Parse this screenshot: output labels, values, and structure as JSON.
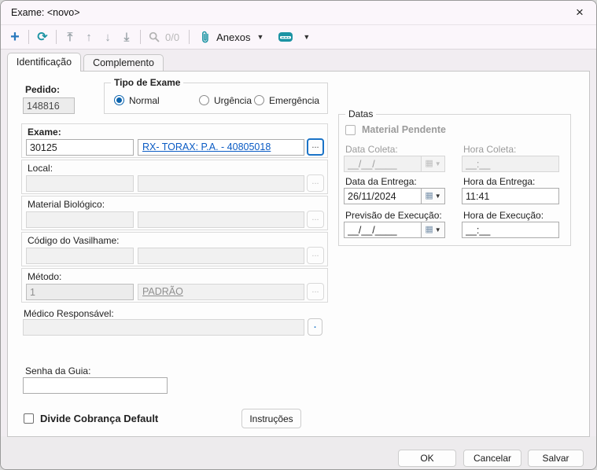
{
  "window": {
    "title": "Exame: <novo>"
  },
  "toolbar": {
    "counter": "0/0",
    "anexos_label": "Anexos"
  },
  "tabs": {
    "identificacao": "Identificação",
    "complemento": "Complemento",
    "active": "Identificação"
  },
  "form": {
    "pedido": {
      "label": "Pedido:",
      "value": "148816"
    },
    "tipo_exame": {
      "legend": "Tipo de Exame",
      "options": [
        "Normal",
        "Urgência",
        "Emergência"
      ],
      "selected": "Normal",
      "normal": "Normal",
      "urgencia": "Urgência",
      "emergencia": "Emergência"
    },
    "exame": {
      "label": "Exame:",
      "code": "30125",
      "name": "RX- TORAX: P.A. - 40805018",
      "browse": "..."
    },
    "local": {
      "label": "Local:",
      "code": "",
      "name": "",
      "browse": "..."
    },
    "material_biologico": {
      "label": "Material Biológico:",
      "code": "",
      "name": "",
      "browse": "..."
    },
    "codigo_vasilhame": {
      "label": "Código do Vasilhame:",
      "code": "",
      "name": "",
      "browse": "..."
    },
    "metodo": {
      "label": "Método:",
      "code": "1",
      "name": "PADRÃO",
      "browse": "..."
    },
    "medico": {
      "label": "Médico Responsável:",
      "value": "",
      "browse": "."
    },
    "senha": {
      "label": "Senha da Guia:",
      "value": ""
    },
    "divide_cobranca": {
      "label": "Divide Cobrança Default",
      "checked": false
    },
    "instrucoes_button": "Instruções"
  },
  "datas": {
    "legend": "Datas",
    "material_pendente": {
      "label": "Material Pendente",
      "checked": false,
      "enabled": false
    },
    "data_coleta": {
      "label": "Data Coleta:",
      "value": "__/__/____",
      "enabled": false
    },
    "hora_coleta": {
      "label": "Hora Coleta:",
      "value": "__:__",
      "enabled": false
    },
    "data_entrega": {
      "label": "Data da Entrega:",
      "value": "26/11/2024",
      "enabled": true
    },
    "hora_entrega": {
      "label": "Hora da Entrega:",
      "value": "11:41",
      "enabled": true
    },
    "previsao_execucao": {
      "label": "Previsão de Execução:",
      "value": "__/__/____",
      "enabled": true
    },
    "hora_execucao": {
      "label": "Hora de Execução:",
      "value": "__:__",
      "enabled": true
    }
  },
  "footer": {
    "ok": "OK",
    "cancelar": "Cancelar",
    "salvar": "Salvar"
  },
  "colors": {
    "accent_blue": "#1a73c7",
    "toolbar_teal": "#1b93a3",
    "toolbar_plus_blue": "#2878bd",
    "link_blue": "#0a5bc4",
    "radio_blue": "#0b63ad",
    "titlebar_bg": "#fbf6fb",
    "page_bg": "#fdfdfd"
  }
}
